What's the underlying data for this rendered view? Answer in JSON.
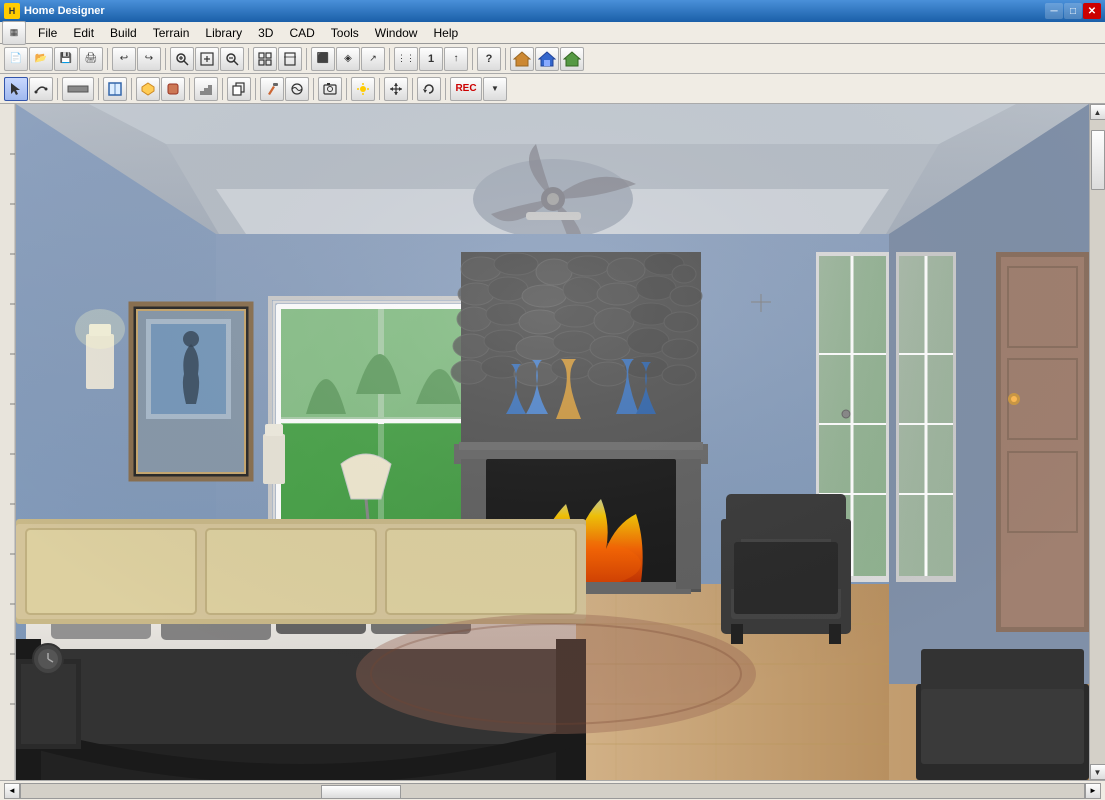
{
  "app": {
    "title": "Home Designer",
    "icon_label": "H"
  },
  "title_bar": {
    "title": "Home Designer",
    "minimize": "─",
    "maximize": "□",
    "close": "✕"
  },
  "menu": {
    "items": [
      "File",
      "Edit",
      "Build",
      "Terrain",
      "Library",
      "3D",
      "CAD",
      "Tools",
      "Window",
      "Help"
    ]
  },
  "toolbar1": {
    "buttons": [
      {
        "name": "new",
        "icon": "📄"
      },
      {
        "name": "open",
        "icon": "📂"
      },
      {
        "name": "save",
        "icon": "💾"
      },
      {
        "name": "print",
        "icon": "🖨"
      },
      {
        "name": "sep1",
        "icon": ""
      },
      {
        "name": "undo",
        "icon": "↩"
      },
      {
        "name": "redo",
        "icon": "↪"
      },
      {
        "name": "zoom-in-tb",
        "icon": "🔍+"
      },
      {
        "name": "zoom-in2",
        "icon": "⊕"
      },
      {
        "name": "zoom-out",
        "icon": "⊖"
      },
      {
        "name": "sep2",
        "icon": ""
      },
      {
        "name": "fit-page",
        "icon": "⊡"
      },
      {
        "name": "fit-page2",
        "icon": "⊞"
      },
      {
        "name": "sep3",
        "icon": ""
      },
      {
        "name": "tool1",
        "icon": "⬛"
      },
      {
        "name": "tool2",
        "icon": "◈"
      },
      {
        "name": "tool3",
        "icon": "↗"
      },
      {
        "name": "sep4",
        "icon": ""
      },
      {
        "name": "tool4",
        "icon": "⋮"
      },
      {
        "name": "tool5",
        "icon": "1"
      },
      {
        "name": "tool6",
        "icon": "↑"
      },
      {
        "name": "sep5",
        "icon": ""
      },
      {
        "name": "tool7",
        "icon": "?"
      },
      {
        "name": "sep6",
        "icon": ""
      },
      {
        "name": "house1",
        "icon": "🏠"
      },
      {
        "name": "house2",
        "icon": "🏡"
      },
      {
        "name": "house3",
        "icon": "⌂"
      }
    ]
  },
  "toolbar2": {
    "buttons": [
      {
        "name": "select",
        "icon": "↖"
      },
      {
        "name": "polyline",
        "icon": "∿"
      },
      {
        "name": "sep1",
        "icon": ""
      },
      {
        "name": "dimension",
        "icon": "⟷"
      },
      {
        "name": "sep2",
        "icon": ""
      },
      {
        "name": "fill",
        "icon": "▣"
      },
      {
        "name": "sep3",
        "icon": ""
      },
      {
        "name": "object1",
        "icon": "⌂"
      },
      {
        "name": "sep4",
        "icon": ""
      },
      {
        "name": "object2",
        "icon": "⬡"
      },
      {
        "name": "sep5",
        "icon": ""
      },
      {
        "name": "copy",
        "icon": "⊕"
      },
      {
        "name": "sep6",
        "icon": ""
      },
      {
        "name": "paint",
        "icon": "✏"
      },
      {
        "name": "material",
        "icon": "≋"
      },
      {
        "name": "sep7",
        "icon": ""
      },
      {
        "name": "camera",
        "icon": "📷"
      },
      {
        "name": "sep8",
        "icon": ""
      },
      {
        "name": "light",
        "icon": "☀"
      },
      {
        "name": "sep9",
        "icon": ""
      },
      {
        "name": "move",
        "icon": "✥"
      },
      {
        "name": "sep10",
        "icon": ""
      },
      {
        "name": "rotate",
        "icon": "↻"
      },
      {
        "name": "sep11",
        "icon": ""
      },
      {
        "name": "rec",
        "icon": "REC"
      }
    ]
  },
  "status_bar": {
    "text": ""
  },
  "scene": {
    "description": "3D bedroom interior with fireplace"
  }
}
